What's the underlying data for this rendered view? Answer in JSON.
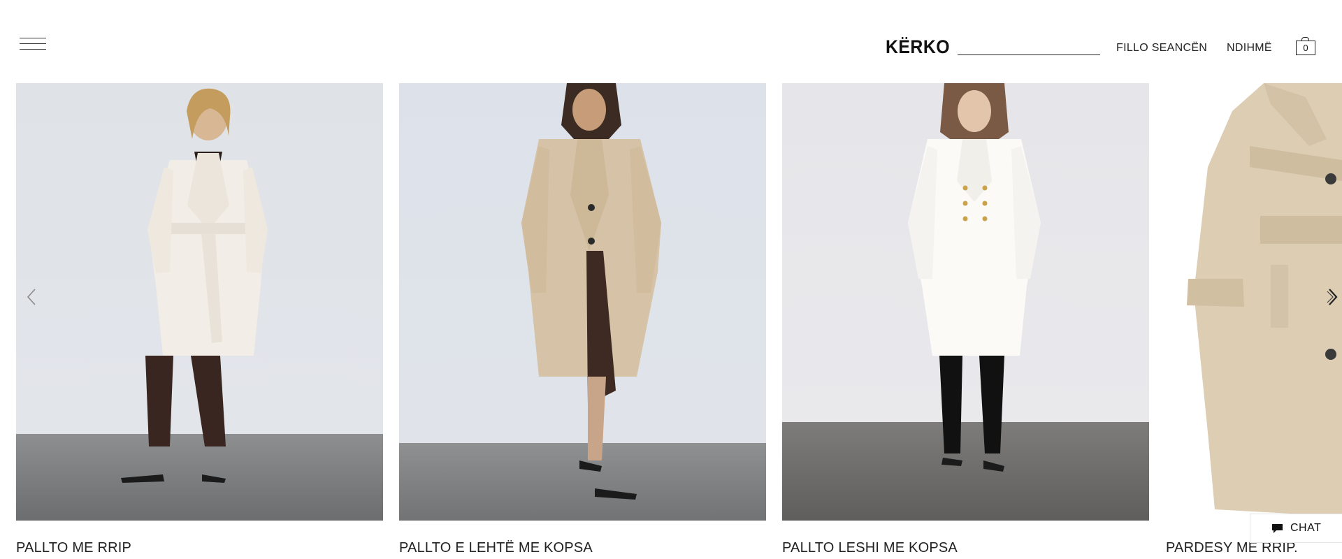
{
  "header": {
    "menu_icon": "hamburger-menu-icon",
    "search_label": "KËRKO",
    "search_value": "",
    "login_label": "FILLO SEANCËN",
    "help_label": "NDIHMË",
    "cart_icon": "shopping-bag-icon",
    "cart_count": "0"
  },
  "products": [
    {
      "name": "PALLTO ME RRIP",
      "color": "#f4efe8"
    },
    {
      "name": "PALLTO E LEHTË ME KOPSA",
      "color": "#d8c4a8"
    },
    {
      "name": "PALLTO LESHI ME KOPSA",
      "color": "#fbfaf6"
    },
    {
      "name": "PARDESY ME RRIP.",
      "color": "#dccdb3"
    }
  ],
  "carousel": {
    "prev_icon": "chevron-left-icon",
    "next_icon": "chevron-right-icon"
  },
  "chat": {
    "label": "CHAT",
    "icon": "chat-bubble-icon"
  }
}
